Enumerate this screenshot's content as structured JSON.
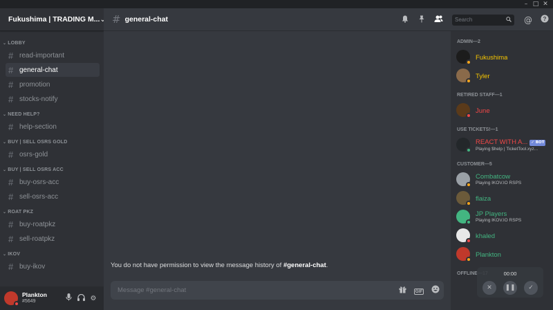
{
  "server": {
    "name": "Fukushima | TRADING M...",
    "chevron_icon": "chevron-down-icon"
  },
  "sidebar": {
    "sections": [
      {
        "category": "LOBBY",
        "channels": [
          {
            "name": "read-important",
            "active": false
          },
          {
            "name": "general-chat",
            "active": true
          },
          {
            "name": "promotion",
            "active": false
          },
          {
            "name": "stocks-notify",
            "active": false
          }
        ]
      },
      {
        "category": "NEED HELP?",
        "channels": [
          {
            "name": "help-section",
            "active": false
          }
        ]
      },
      {
        "category": "BUY | SELL OSRS GOLD",
        "channels": [
          {
            "name": "osrs-gold",
            "active": false
          }
        ]
      },
      {
        "category": "BUY | SELL OSRS ACC",
        "channels": [
          {
            "name": "buy-osrs-acc",
            "active": false
          },
          {
            "name": "sell-osrs-acc",
            "active": false
          }
        ]
      },
      {
        "category": "ROAT PKZ",
        "channels": [
          {
            "name": "buy-roatpkz",
            "active": false
          },
          {
            "name": "sell-roatpkz",
            "active": false
          }
        ]
      },
      {
        "category": "IKOV",
        "channels": [
          {
            "name": "buy-ikov",
            "active": false
          }
        ]
      }
    ]
  },
  "user": {
    "name": "Plankton",
    "tag": "#5649",
    "status_color": "#f04747",
    "avatar_color": "#c0392b"
  },
  "channel_header": {
    "title": "general-chat",
    "search_placeholder": "Search"
  },
  "messages": {
    "no_permission_prefix": "You do not have permission to view the message history of ",
    "channel_ref": "#general-chat",
    "suffix": "."
  },
  "composer": {
    "placeholder": "Message #general-chat",
    "gif_label": "GIF"
  },
  "members": {
    "groups": [
      {
        "title": "ADMIN—2",
        "members": [
          {
            "name": "Fukushima",
            "color": "#f5c400",
            "avatar": "#1c1c1c",
            "status": "#faa61a"
          },
          {
            "name": "Tyler",
            "color": "#f5c400",
            "avatar": "#8a6a4a",
            "status": "#faa61a"
          }
        ]
      },
      {
        "title": "RETIRED STAFF—1",
        "members": [
          {
            "name": "June",
            "color": "#f04747",
            "avatar": "#5a3a1a",
            "status": "#f04747"
          }
        ]
      },
      {
        "title": "USE TICKETS!—1",
        "members": [
          {
            "name": "REACT WITH A...",
            "color": "#f04747",
            "avatar": "#23272a",
            "status": "#43b581",
            "bot": "✓ BOT",
            "activity": "Playing $help | TicketTool.xyz..."
          }
        ]
      },
      {
        "title": "CUSTOMER—5",
        "members": [
          {
            "name": "Combatcow",
            "color": "#43b581",
            "avatar": "#9aa0a6",
            "status": "#faa61a",
            "activity": "Playing IKOV.IO RSPS"
          },
          {
            "name": "flaiza",
            "color": "#43b581",
            "avatar": "#6b5a3a",
            "status": "#faa61a"
          },
          {
            "name": "JP Players",
            "color": "#43b581",
            "avatar": "#43b581",
            "status": "#43b581",
            "activity": "Playing IKOV.IO RSPS"
          },
          {
            "name": "khaled",
            "color": "#43b581",
            "avatar": "#e8e8e8",
            "status": "#f04747"
          },
          {
            "name": "Plankton",
            "color": "#43b581",
            "avatar": "#c0392b",
            "status": "#faa61a"
          }
        ]
      },
      {
        "title": "OFFLINE—17",
        "members": []
      }
    ]
  },
  "recorder": {
    "time": "00:00"
  }
}
